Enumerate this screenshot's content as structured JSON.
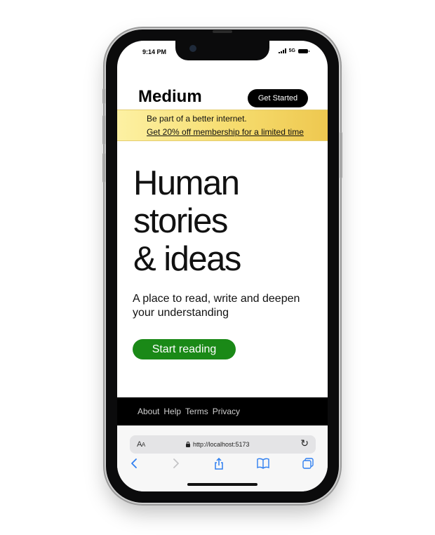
{
  "status": {
    "time": "9:14 PM",
    "network": "5G"
  },
  "header": {
    "logo": "Medium",
    "cta": "Get Started"
  },
  "promo": {
    "line": "Be part of a better internet.",
    "link": "Get 20% off membership for a limited time"
  },
  "hero": {
    "lines": [
      "Human",
      "stories",
      "& ideas"
    ]
  },
  "subtitle": "A place to read, write and deepen your understanding",
  "start_button": "Start reading",
  "footer": {
    "links": [
      "About",
      "Help",
      "Terms",
      "Privacy"
    ]
  },
  "browser": {
    "aa_big": "A",
    "aa_small": "A",
    "url": "http://localhost:5173",
    "icons": [
      "back-icon",
      "forward-icon",
      "share-icon",
      "bookmarks-icon",
      "tabs-icon",
      "reload-icon",
      "lock-icon"
    ]
  },
  "colors": {
    "start_button": "#1a8917",
    "promo_start": "#fdf1a3",
    "promo_end": "#eec850",
    "footer_bg": "#000000",
    "nav_blue": "#2f7ff0"
  }
}
